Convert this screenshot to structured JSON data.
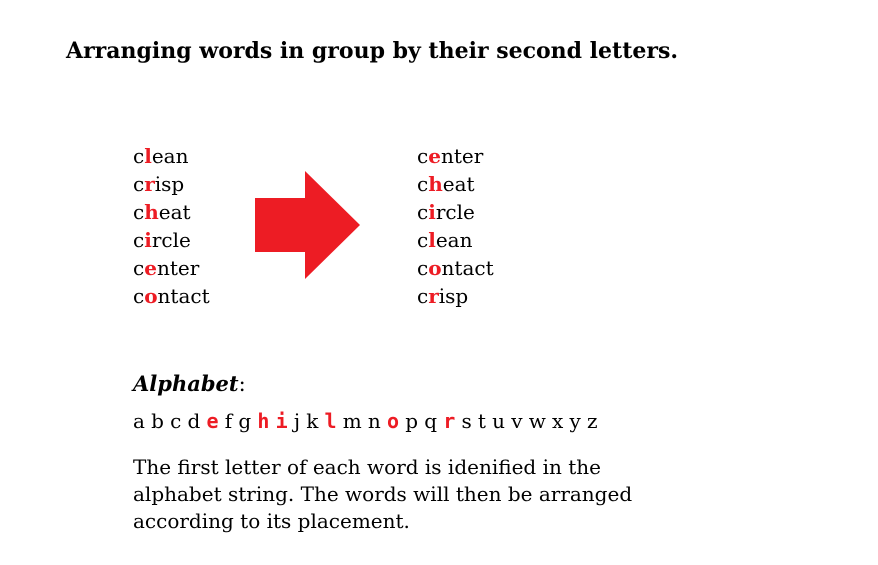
{
  "title": "Arranging words in group by their second letters.",
  "highlight_color": "#ed1c24",
  "before": [
    {
      "first": "c",
      "second": "l",
      "rest": "ean"
    },
    {
      "first": "c",
      "second": "r",
      "rest": "isp"
    },
    {
      "first": "c",
      "second": "h",
      "rest": "eat"
    },
    {
      "first": "c",
      "second": "i",
      "rest": "rcle"
    },
    {
      "first": "c",
      "second": "e",
      "rest": "nter"
    },
    {
      "first": "c",
      "second": "o",
      "rest": "ntact"
    }
  ],
  "after": [
    {
      "first": "c",
      "second": "e",
      "rest": "nter"
    },
    {
      "first": "c",
      "second": "h",
      "rest": "eat"
    },
    {
      "first": "c",
      "second": "i",
      "rest": "rcle"
    },
    {
      "first": "c",
      "second": "l",
      "rest": "ean"
    },
    {
      "first": "c",
      "second": "o",
      "rest": "ntact"
    },
    {
      "first": "c",
      "second": "r",
      "rest": "isp"
    }
  ],
  "arrow_icon": "right-arrow-icon",
  "alphabet": {
    "label": "Alphabet",
    "suffix": ":",
    "letters": [
      "a",
      "b",
      "c",
      "d",
      "e",
      "f",
      "g",
      "h",
      "i",
      "j",
      "k",
      "l",
      "m",
      "n",
      "o",
      "p",
      "q",
      "r",
      "s",
      "t",
      "u",
      "v",
      "w",
      "x",
      "y",
      "z"
    ],
    "highlighted": [
      "e",
      "h",
      "i",
      "l",
      "o",
      "r"
    ]
  },
  "explanation": "The first letter of each word is idenified in the alphabet string. The words will then be arranged according to its placement."
}
